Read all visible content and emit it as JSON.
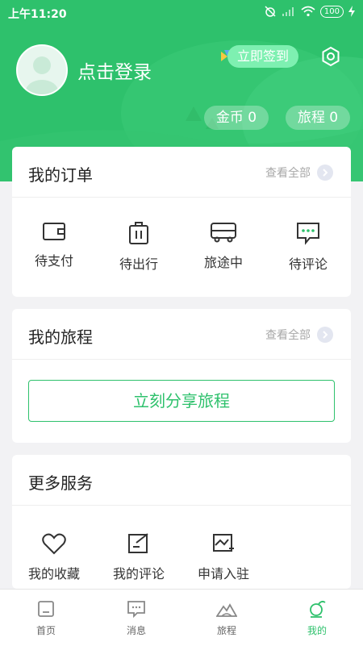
{
  "status_bar": {
    "time": "上午11:20",
    "battery": "100"
  },
  "header": {
    "login_label": "点击登录",
    "checkin_label": "立即签到",
    "coins_label": "金币",
    "coins_value": "0",
    "trips_label": "旅程",
    "trips_value": "0"
  },
  "orders": {
    "title": "我的订单",
    "view_all": "查看全部",
    "items": [
      {
        "label": "待支付",
        "icon": "wallet-icon"
      },
      {
        "label": "待出行",
        "icon": "luggage-icon"
      },
      {
        "label": "旅途中",
        "icon": "bus-icon"
      },
      {
        "label": "待评论",
        "icon": "comment-icon"
      }
    ]
  },
  "trips": {
    "title": "我的旅程",
    "view_all": "查看全部",
    "share_label": "立刻分享旅程"
  },
  "services": {
    "title": "更多服务",
    "items": [
      {
        "label": "我的收藏",
        "icon": "heart-icon"
      },
      {
        "label": "我的评论",
        "icon": "edit-icon"
      },
      {
        "label": "申请入驻",
        "icon": "apply-icon"
      }
    ]
  },
  "tabbar": {
    "items": [
      {
        "label": "首页",
        "icon": "home-icon"
      },
      {
        "label": "消息",
        "icon": "message-icon"
      },
      {
        "label": "旅程",
        "icon": "mountain-icon"
      },
      {
        "label": "我的",
        "icon": "profile-icon"
      }
    ],
    "active": "我的"
  },
  "colors": {
    "brand": "#2ec16c",
    "background": "#f2f2f4"
  }
}
